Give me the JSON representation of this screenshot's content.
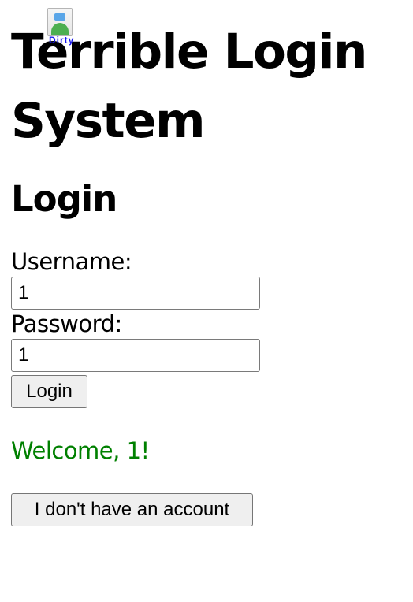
{
  "logo": {
    "alt_text": "Dirty",
    "icon": "broken-image-icon"
  },
  "header": {
    "title": "Terrible Login System"
  },
  "login": {
    "heading": "Login",
    "username_label": "Username:",
    "username_value": "1",
    "password_label": "Password:",
    "password_value": "1",
    "submit_label": "Login"
  },
  "status": {
    "message": "Welcome, 1!",
    "color": "#008000"
  },
  "signup": {
    "button_label": "I don't have an account"
  }
}
